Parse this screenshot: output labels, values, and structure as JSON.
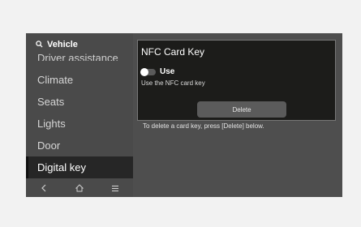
{
  "sidebar": {
    "search_label": "Vehicle",
    "cut_off_item": "Driver assistance",
    "items": [
      {
        "label": "Climate"
      },
      {
        "label": "Seats"
      },
      {
        "label": "Lights"
      },
      {
        "label": "Door"
      },
      {
        "label": "Digital key"
      }
    ],
    "active_item": "Digital key"
  },
  "nav": {
    "icons": [
      "back-icon",
      "home-icon",
      "menu-icon"
    ]
  },
  "panel": {
    "title": "NFC Card Key",
    "toggle_label": "Use",
    "toggle_state": "off",
    "toggle_description": "Use the NFC card key",
    "delete_label": "Delete"
  },
  "instruction": "To delete a card key, press [Delete] below.",
  "colors": {
    "page_bg": "#f2f2f2",
    "screen_bg": "#4e4e4e",
    "panel_bg": "#1c1c1a",
    "active_item_bg": "#262626",
    "button_bg": "#5b5b5b"
  }
}
